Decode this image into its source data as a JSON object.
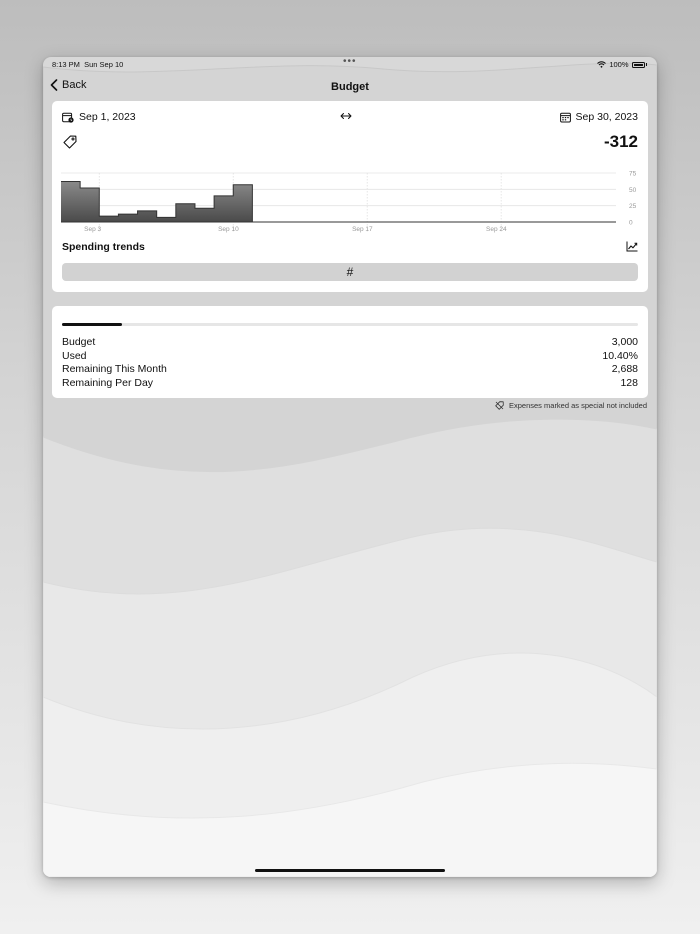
{
  "status": {
    "time": "8:13 PM",
    "date": "Sun Sep 10",
    "battery": "100%"
  },
  "nav": {
    "back_label": "Back",
    "title": "Budget"
  },
  "range": {
    "start": "Sep 1, 2023",
    "end": "Sep 30, 2023"
  },
  "summary": {
    "total": "-312"
  },
  "trends": {
    "title": "Spending trends",
    "button_label": "#"
  },
  "budget": {
    "progress_fraction": 0.104,
    "rows": [
      {
        "label": "Budget",
        "value": "3,000"
      },
      {
        "label": "Used",
        "value": "10.40%"
      },
      {
        "label": "Remaining This Month",
        "value": "2,688"
      },
      {
        "label": "Remaining Per Day",
        "value": "128"
      }
    ]
  },
  "footnote": "Expenses marked as special not included",
  "chart_data": {
    "type": "area",
    "step": true,
    "x_day_range": [
      1,
      30
    ],
    "points": [
      {
        "day": 1,
        "value": 62
      },
      {
        "day": 2,
        "value": 52
      },
      {
        "day": 3,
        "value": 9
      },
      {
        "day": 4,
        "value": 12
      },
      {
        "day": 5,
        "value": 17
      },
      {
        "day": 6,
        "value": 7
      },
      {
        "day": 7,
        "value": 28
      },
      {
        "day": 8,
        "value": 21
      },
      {
        "day": 9,
        "value": 40
      },
      {
        "day": 10,
        "value": 57
      },
      {
        "day": 11,
        "value": 0
      },
      {
        "day": 30,
        "value": 0
      }
    ],
    "ylim": [
      0,
      75
    ],
    "yticks": [
      75,
      50,
      25,
      0
    ],
    "xticks": [
      {
        "day": 3,
        "label": "Sep 3"
      },
      {
        "day": 10,
        "label": "Sep 10"
      },
      {
        "day": 17,
        "label": "Sep 17"
      },
      {
        "day": 24,
        "label": "Sep 24"
      }
    ],
    "grid": true
  }
}
